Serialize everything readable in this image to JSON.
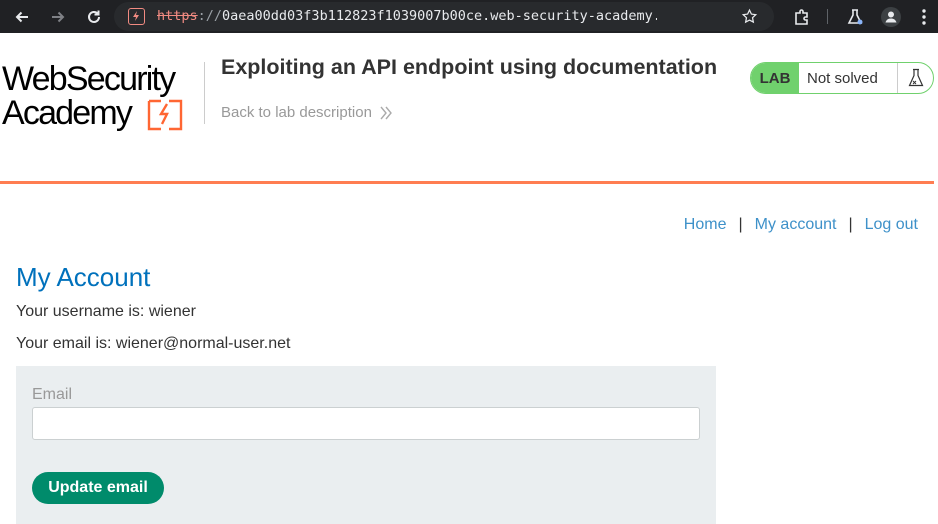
{
  "browser": {
    "url_scheme": "https",
    "url_sep": "://",
    "url_rest": "0aea00dd03f3b112823f1039007b00ce.web-security-academy.n..."
  },
  "logo": {
    "line1": "WebSecurity",
    "line2": "Academy",
    "accent_color": "#ff6633"
  },
  "lab": {
    "title": "Exploiting an API endpoint using documentation",
    "back_link": "Back to lab description",
    "status_tag": "LAB",
    "status_text": "Not solved",
    "status_color": "#70d16d"
  },
  "nav": {
    "home": "Home",
    "sep": "|",
    "my_account": "My account",
    "logout": "Log out"
  },
  "account": {
    "title": "My Account",
    "username_line": "Your username is: wiener",
    "email_line": "Your email is: wiener@normal-user.net",
    "email_label": "Email",
    "email_value": "",
    "update_button": "Update email"
  }
}
